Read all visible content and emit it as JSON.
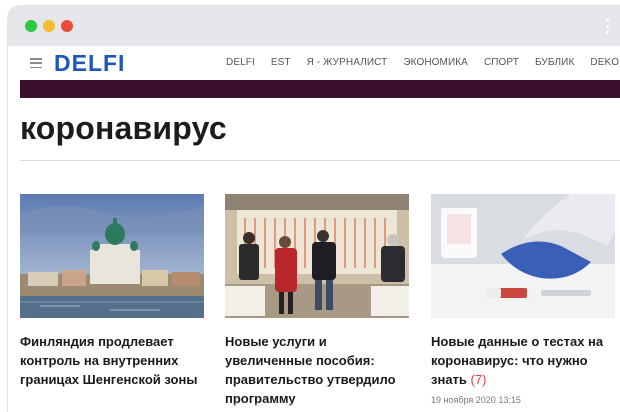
{
  "window": {
    "controls": [
      "close",
      "minimize",
      "maximize"
    ],
    "menu_icon": "kebab-icon"
  },
  "site": {
    "logo": "DELFI",
    "menu": [
      "DELFI",
      "EST",
      "Я - ЖУРНАЛИСТ",
      "ЭКОНОМИКА",
      "СПОРТ",
      "БУБЛИК",
      "DEKO"
    ]
  },
  "page": {
    "heading": "коронавирус"
  },
  "articles": [
    {
      "title": "Финляндия продлевает контроль на внутренних границах Шенгенской зоны",
      "image": "helsinki-cathedral-photo"
    },
    {
      "title": "Новые услуги и увеличенные пособия: правительство утвердило программу",
      "image": "people-queue-photo"
    },
    {
      "title": "Новые данные о тестах на коронавирус: что нужно знать",
      "count": "(7)",
      "timestamp": "19 ноября 2020 13:15",
      "image": "lab-test-photo"
    }
  ],
  "colors": {
    "accent_bar": "#3a0f2b",
    "logo": "#1d58b8",
    "comment_count": "#e5384a"
  }
}
